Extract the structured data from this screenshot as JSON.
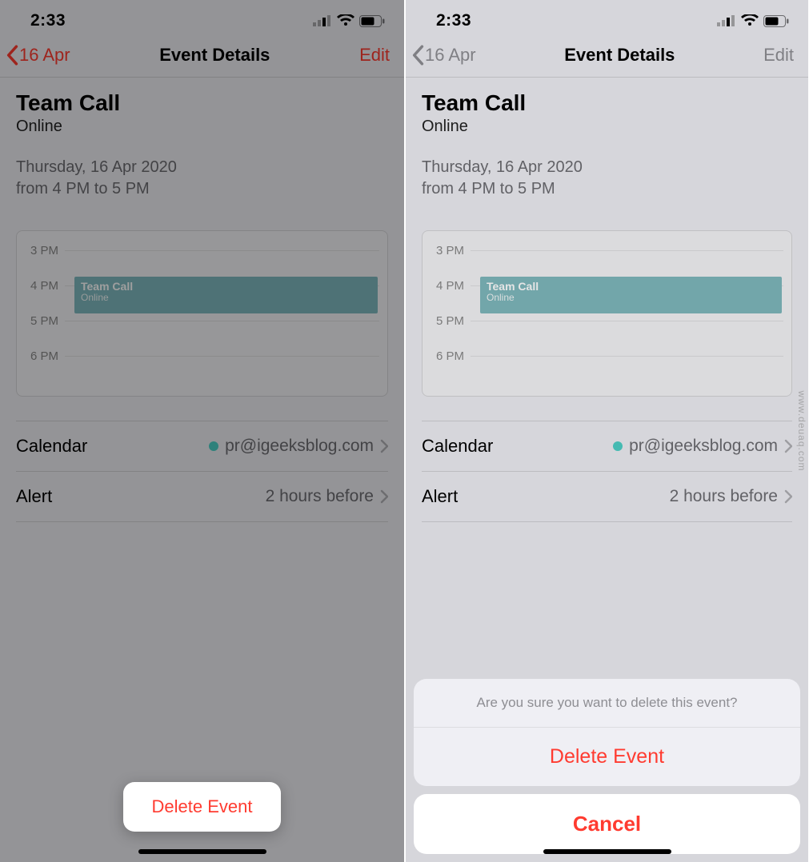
{
  "status": {
    "time": "2:33"
  },
  "nav": {
    "back": "16 Apr",
    "title": "Event Details",
    "edit": "Edit"
  },
  "event": {
    "title": "Team Call",
    "location": "Online",
    "date": "Thursday, 16 Apr 2020",
    "time": "from 4 PM to 5 PM"
  },
  "timeline": {
    "hours": [
      "3 PM",
      "4 PM",
      "5 PM",
      "6 PM"
    ],
    "slot": {
      "title": "Team Call",
      "sub": "Online"
    }
  },
  "rows": {
    "calendar": {
      "label": "Calendar",
      "value": "pr@igeeksblog.com"
    },
    "alert": {
      "label": "Alert",
      "value": "2 hours before"
    }
  },
  "left": {
    "delete": "Delete Event"
  },
  "sheet": {
    "msg": "Are you sure you want to delete this event?",
    "delete": "Delete Event",
    "cancel": "Cancel"
  },
  "watermark": "www.deuaq.com"
}
